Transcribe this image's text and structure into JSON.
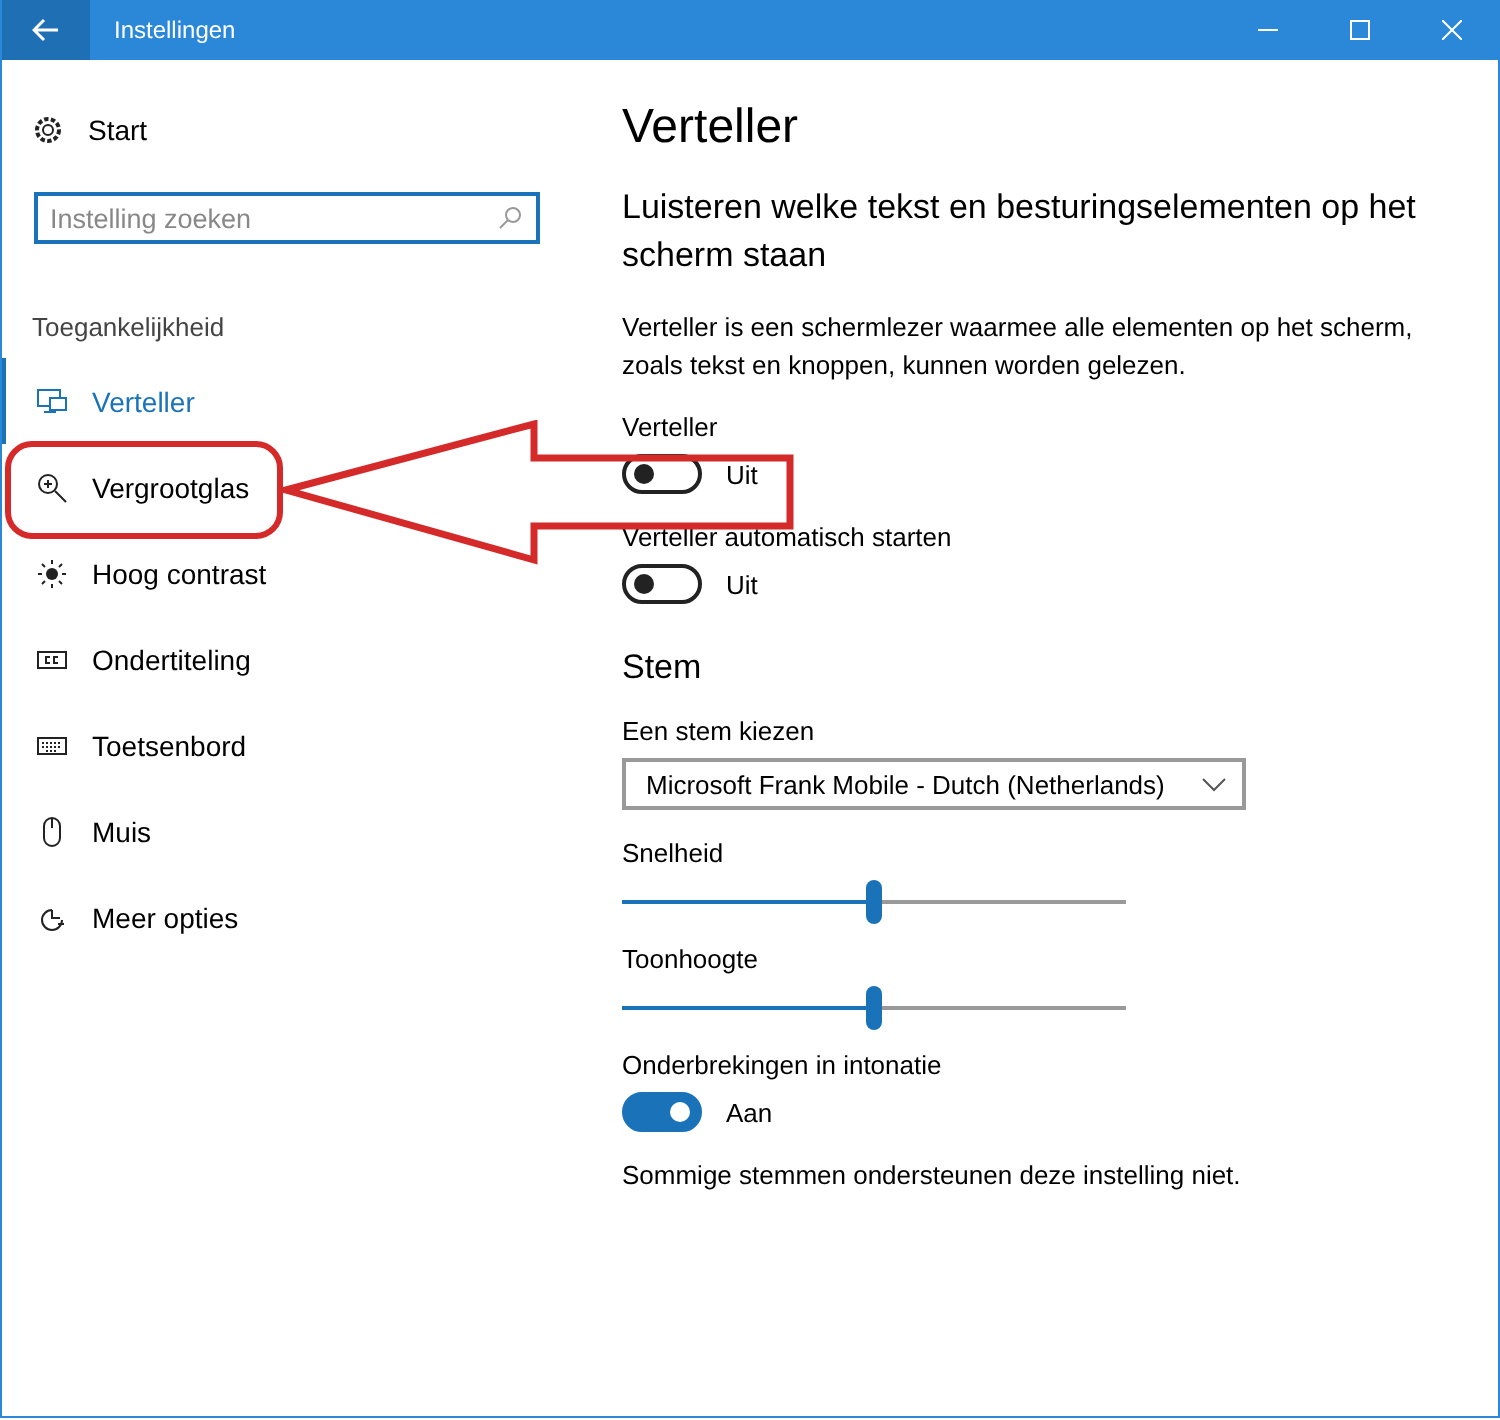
{
  "window": {
    "title": "Instellingen"
  },
  "sidebar": {
    "home": "Start",
    "search": {
      "placeholder": "Instelling zoeken"
    },
    "section": "Toegankelijkheid",
    "items": [
      {
        "label": "Verteller",
        "kind": "monitor",
        "selected": true
      },
      {
        "label": "Vergrootglas",
        "kind": "zoom",
        "selected": false
      },
      {
        "label": "Hoog contrast",
        "kind": "sun",
        "selected": false
      },
      {
        "label": "Ondertiteling",
        "kind": "cc",
        "selected": false
      },
      {
        "label": "Toetsenbord",
        "kind": "keyboard",
        "selected": false
      },
      {
        "label": "Muis",
        "kind": "mouse",
        "selected": false
      },
      {
        "label": "Meer opties",
        "kind": "more",
        "selected": false
      }
    ]
  },
  "content": {
    "title": "Verteller",
    "subtitle": "Luisteren welke tekst en besturingselementen op het scherm staan",
    "description": "Verteller is een schermlezer waarmee alle elementen op het scherm, zoals tekst en knoppen, kunnen worden gelezen.",
    "settings": [
      {
        "kind": "toggle",
        "label": "Verteller",
        "on": false,
        "state": "Uit"
      },
      {
        "kind": "toggle",
        "label": "Verteller automatisch starten",
        "on": false,
        "state": "Uit"
      },
      {
        "kind": "heading",
        "label": "Stem"
      },
      {
        "kind": "dropdown",
        "label": "Een stem kiezen",
        "value": "Microsoft Frank Mobile - Dutch (Netherlands)"
      },
      {
        "kind": "slider",
        "label": "Snelheid",
        "level": 0.5
      },
      {
        "kind": "slider",
        "label": "Toonhoogte",
        "level": 0.5
      },
      {
        "kind": "toggle",
        "label": "Onderbrekingen in intonatie",
        "on": true,
        "state": "Aan"
      },
      {
        "kind": "note",
        "label": "Sommige stemmen ondersteunen deze instelling niet."
      }
    ]
  }
}
